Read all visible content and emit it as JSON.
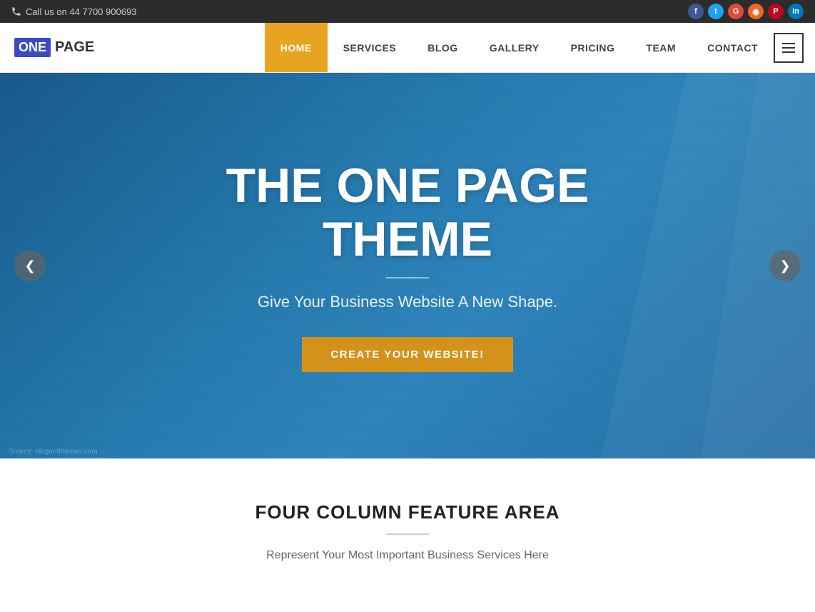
{
  "topbar": {
    "phone_label": "Call us on 44 7700 900693",
    "social": [
      {
        "name": "facebook",
        "class": "si-fb",
        "symbol": "f"
      },
      {
        "name": "twitter",
        "class": "si-tw",
        "symbol": "t"
      },
      {
        "name": "google-plus",
        "class": "si-gp",
        "symbol": "G"
      },
      {
        "name": "rss",
        "class": "si-rss",
        "symbol": "◉"
      },
      {
        "name": "pinterest",
        "class": "si-pin",
        "symbol": "P"
      },
      {
        "name": "linkedin",
        "class": "si-li",
        "symbol": "in"
      }
    ]
  },
  "logo": {
    "one": "ONE",
    "page": "PAGE"
  },
  "nav": {
    "items": [
      {
        "label": "HOME",
        "active": true
      },
      {
        "label": "SERVICES",
        "active": false
      },
      {
        "label": "BLOG",
        "active": false
      },
      {
        "label": "GALLERY",
        "active": false
      },
      {
        "label": "PRICING",
        "active": false
      },
      {
        "label": "TEAM",
        "active": false
      },
      {
        "label": "CONTACT",
        "active": false
      }
    ]
  },
  "hero": {
    "title": "THE ONE PAGE THEME",
    "subtitle": "Give Your Business Website A New Shape.",
    "cta_label": "CREATE YOUR WEBSITE!",
    "arrow_left": "❮",
    "arrow_right": "❯"
  },
  "features": {
    "title": "FOUR COLUMN FEATURE AREA",
    "subtitle": "Represent Your Most Important Business Services Here"
  },
  "watermark": {
    "text": "Source: elegantthemes.com"
  }
}
